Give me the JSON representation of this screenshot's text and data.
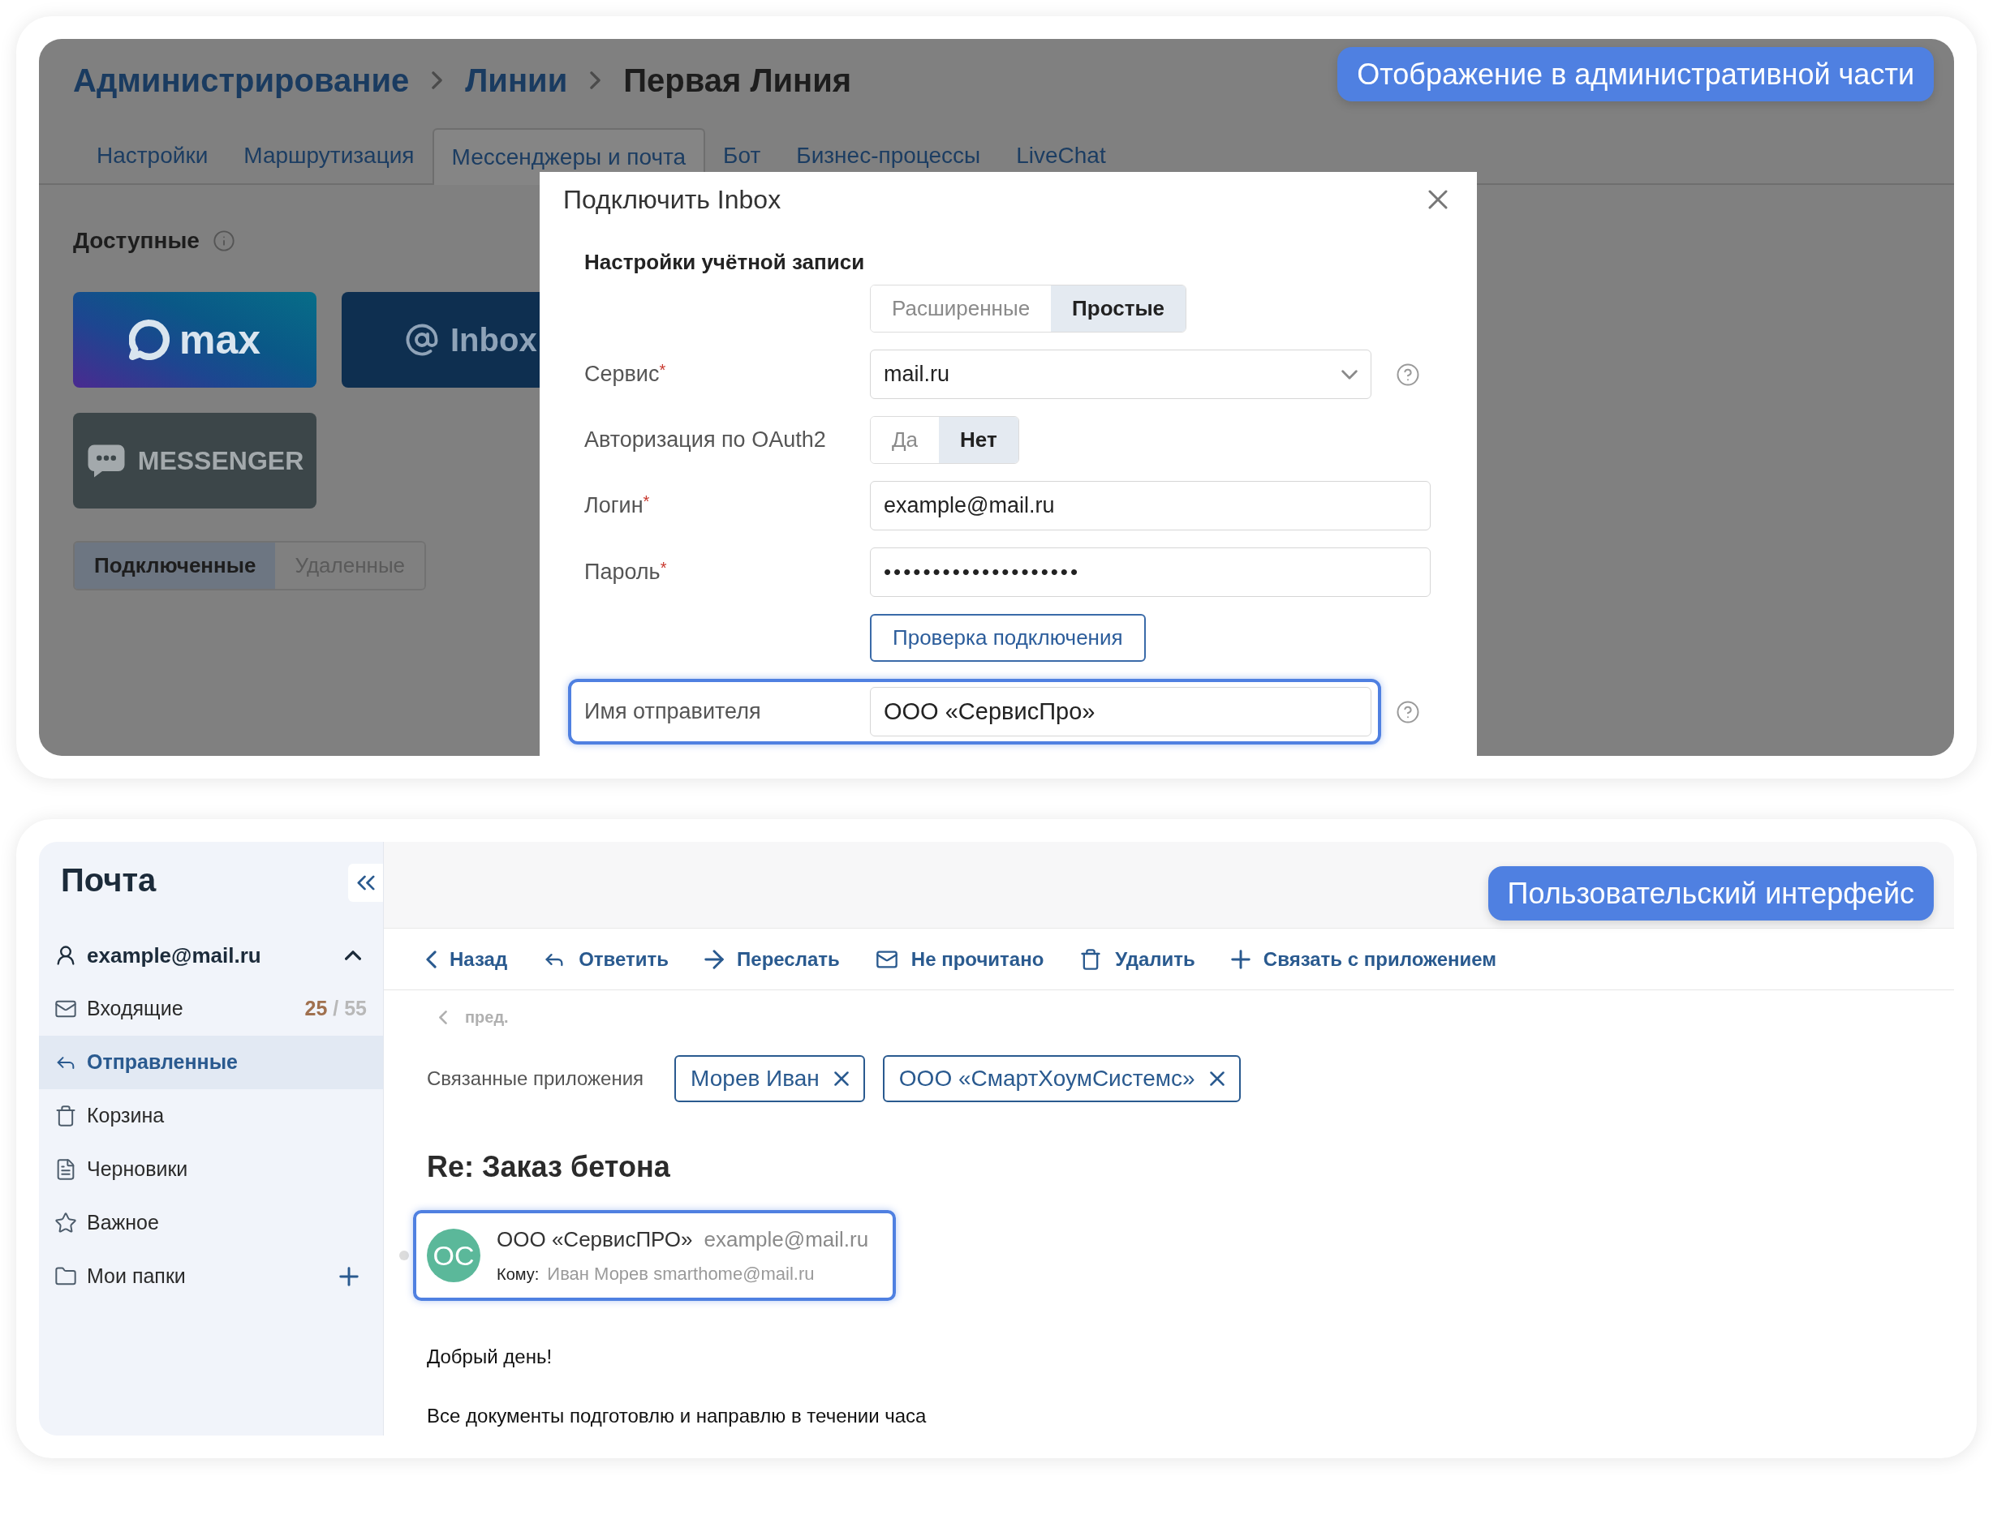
{
  "admin_view": {
    "badge": "Отображение в административной части",
    "breadcrumbs": [
      {
        "label": "Администрирование",
        "current": false
      },
      {
        "label": "Линии",
        "current": false
      },
      {
        "label": "Первая Линия",
        "current": true
      }
    ],
    "tabs": [
      {
        "label": "Настройки",
        "selected": false
      },
      {
        "label": "Маршрутизация",
        "selected": false
      },
      {
        "label": "Мессенджеры и почта",
        "selected": true
      },
      {
        "label": "Бот",
        "selected": false
      },
      {
        "label": "Бизнес-процессы",
        "selected": false
      },
      {
        "label": "LiveChat",
        "selected": false
      }
    ],
    "available": {
      "title": "Доступные",
      "info": true
    },
    "connectors": [
      {
        "kind": "max",
        "label": "max"
      },
      {
        "kind": "inbox",
        "label": "Inbox"
      },
      {
        "kind": "messenger",
        "label": "MESSENGER"
      }
    ],
    "list_filter": [
      {
        "label": "Подключенные",
        "selected": true
      },
      {
        "label": "Удаленные",
        "selected": false
      }
    ],
    "dialog": {
      "title": "Подключить Inbox",
      "section": "Настройки учётной записи",
      "fields": [
        {
          "kind": "segmented",
          "options": [
            {
              "label": "Расширенные",
              "selected": false
            },
            {
              "label": "Простые",
              "selected": true
            }
          ]
        },
        {
          "kind": "select",
          "label": "Сервис",
          "mark": "*",
          "value": "mail.ru",
          "help": true
        },
        {
          "kind": "segmented",
          "label": "Авторизация по OAuth2",
          "options": [
            {
              "label": "Да",
              "selected": false
            },
            {
              "label": "Нет",
              "selected": true
            }
          ]
        },
        {
          "kind": "text",
          "label": "Логин",
          "mark": "*",
          "value": "example@mail.ru"
        },
        {
          "kind": "password",
          "label": "Пароль",
          "mark": "*",
          "value": "••••••••••••••••••••"
        },
        {
          "kind": "button",
          "label": "Проверка подключения"
        },
        {
          "kind": "text",
          "label": "Имя отправителя",
          "value": "ООО «СервисПро»",
          "help": true,
          "highlighted": true
        }
      ]
    }
  },
  "mail_view": {
    "badge": "Пользовательский интерфейс",
    "sidebar": {
      "title": "Почта",
      "account": {
        "email": "example@mail.ru",
        "expanded": true
      },
      "folders": [
        {
          "kind": "inbox",
          "label": "Входящие",
          "unread": "25",
          "total": "/ 55",
          "selected": false
        },
        {
          "kind": "sent",
          "label": "Отправленные",
          "selected": true
        },
        {
          "kind": "trash",
          "label": "Корзина",
          "selected": false
        },
        {
          "kind": "drafts",
          "label": "Черновики",
          "selected": false
        },
        {
          "kind": "important",
          "label": "Важное",
          "selected": false
        },
        {
          "kind": "custom",
          "label": "Мои папки",
          "selected": false,
          "can_add": true
        }
      ]
    },
    "toolbar": [
      {
        "kind": "back",
        "label": "Назад"
      },
      {
        "kind": "reply",
        "label": "Ответить"
      },
      {
        "kind": "forward",
        "label": "Переслать"
      },
      {
        "kind": "unread",
        "label": "Не прочитано"
      },
      {
        "kind": "delete",
        "label": "Удалить"
      },
      {
        "kind": "link",
        "label": "Связать с приложением"
      }
    ],
    "prev_link": "пред.",
    "linked_apps": {
      "label": "Связанные приложения",
      "items": [
        {
          "label": "Морев Иван"
        },
        {
          "label": "ООО «СмартХоумСистемс»"
        }
      ]
    },
    "message": {
      "subject": "Re: Заказ бетона",
      "sender": {
        "initials": "ОС",
        "name": "ООО «СервисПРО»",
        "email": "example@mail.ru",
        "to_label": "Кому:",
        "to": "Иван Морев smarthome@mail.ru",
        "highlighted": true
      },
      "body": [
        "Добрый день!",
        "Все документы подготовлю и направлю в течении часа"
      ]
    }
  }
}
